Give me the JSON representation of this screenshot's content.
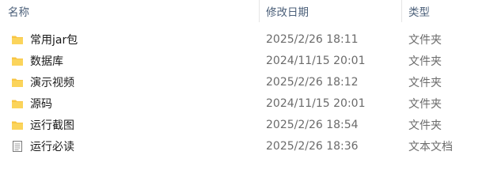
{
  "columns": {
    "name": "名称",
    "date": "修改日期",
    "type": "类型"
  },
  "sort_caret": "^",
  "files": [
    {
      "name": "常用jar包",
      "date": "2025/2/26 18:11",
      "type": "文件夹",
      "icon": "folder-icon"
    },
    {
      "name": "数据库",
      "date": "2024/11/15 20:01",
      "type": "文件夹",
      "icon": "folder-icon"
    },
    {
      "name": "演示视频",
      "date": "2025/2/26 18:12",
      "type": "文件夹",
      "icon": "folder-icon"
    },
    {
      "name": "源码",
      "date": "2024/11/15 20:01",
      "type": "文件夹",
      "icon": "folder-icon"
    },
    {
      "name": "运行截图",
      "date": "2025/2/26 18:54",
      "type": "文件夹",
      "icon": "folder-icon"
    },
    {
      "name": "运行必读",
      "date": "2025/2/26 18:36",
      "type": "文本文档",
      "icon": "text-document-icon"
    }
  ],
  "colors": {
    "header_text": "#4c607a",
    "folder": "#f8c543",
    "secondary_text": "#6b6b6b"
  }
}
